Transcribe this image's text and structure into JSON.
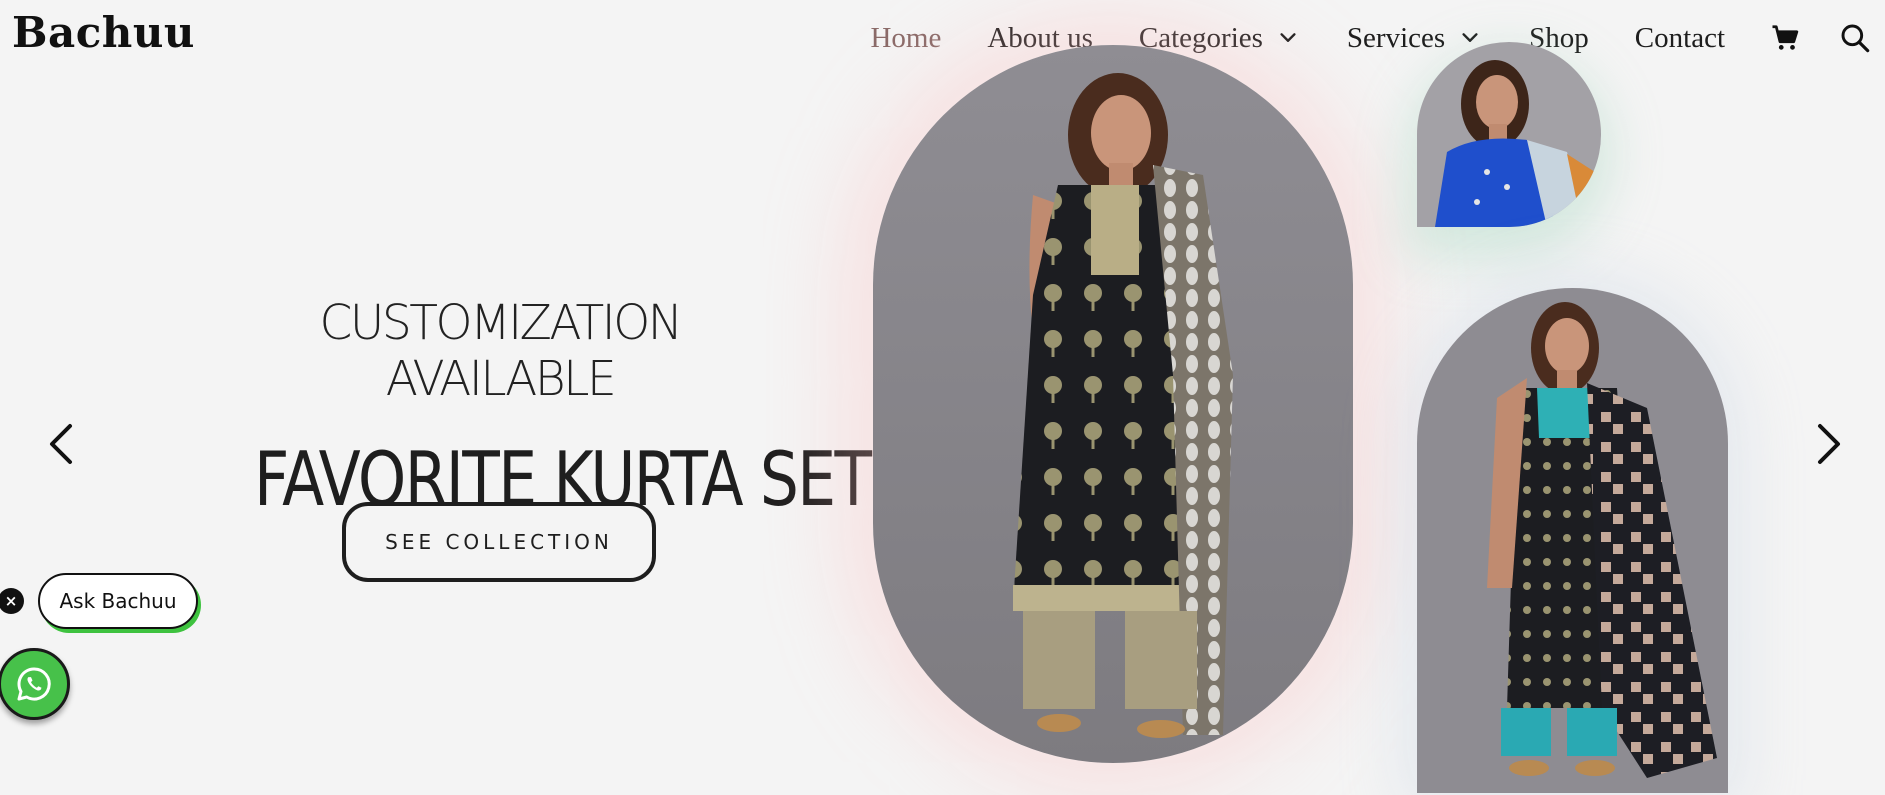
{
  "brand": {
    "name": "Bachuu"
  },
  "nav": {
    "items": [
      {
        "label": "Home",
        "active": true,
        "dropdown": false
      },
      {
        "label": "About us",
        "active": false,
        "dropdown": false
      },
      {
        "label": "Categories",
        "active": false,
        "dropdown": true
      },
      {
        "label": "Services",
        "active": false,
        "dropdown": true
      },
      {
        "label": "Shop",
        "active": false,
        "dropdown": false
      },
      {
        "label": "Contact",
        "active": false,
        "dropdown": false
      }
    ],
    "icons": [
      "cart-icon",
      "search-icon"
    ]
  },
  "hero": {
    "subtitle": "CUSTOMIZATION AVAILABLE",
    "title": "FAVORITE KURTA SETS",
    "cta_label": "SEE COLLECTION"
  },
  "carousel": {
    "prev_icon": "chevron-left-icon",
    "next_icon": "chevron-right-icon"
  },
  "chat": {
    "close_symbol": "×",
    "ask_label": "Ask Bachuu",
    "whatsapp_icon": "whatsapp-icon"
  },
  "colors": {
    "background": "#f4f4f4",
    "text": "#1e1e1e",
    "nav_active": "#8a6a68",
    "whatsapp_green": "#47c14a",
    "photo_backdrop": "#8f8d92"
  }
}
